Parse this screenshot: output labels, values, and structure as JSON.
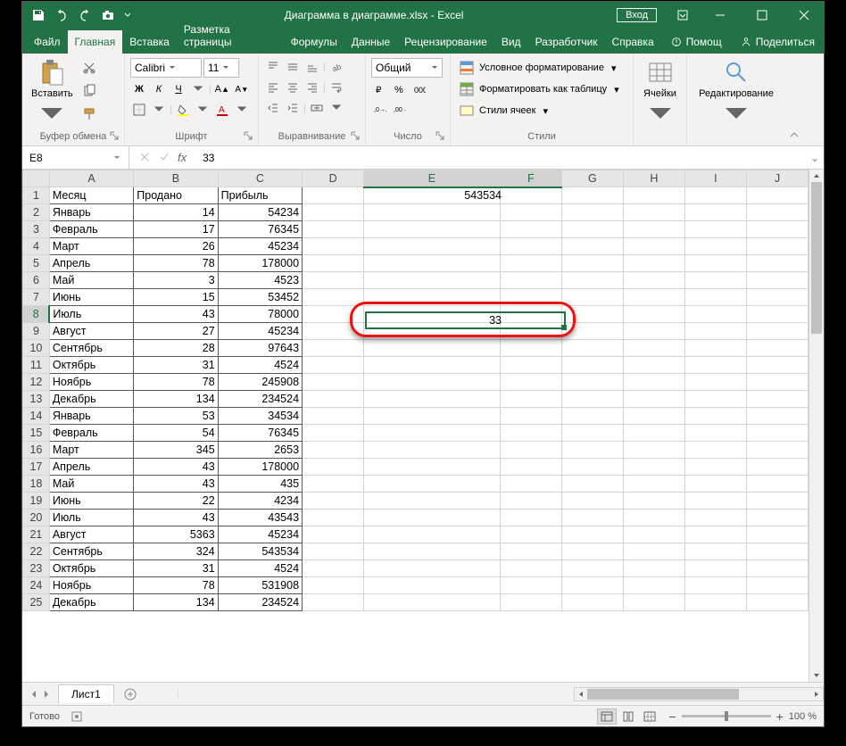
{
  "title": {
    "doc": "Диаграмма в диаграмме.xlsx",
    "app": "Excel",
    "sep": " - "
  },
  "login_btn": "Вход",
  "tabs": [
    "Файл",
    "Главная",
    "Вставка",
    "Разметка страницы",
    "Формулы",
    "Данные",
    "Рецензирование",
    "Вид",
    "Разработчик",
    "Справка"
  ],
  "active_tab": 1,
  "help_hint": "Помощ",
  "share": "Поделиться",
  "ribbon": {
    "clipboard": {
      "paste": "Вставить",
      "title": "Буфер обмена"
    },
    "font": {
      "name": "Calibri",
      "size": "11",
      "title": "Шрифт"
    },
    "align": {
      "title": "Выравнивание"
    },
    "number": {
      "format": "Общий",
      "title": "Число"
    },
    "styles": {
      "cond": "Условное форматирование",
      "table": "Форматировать как таблицу",
      "cell": "Стили ячеек",
      "title": "Стили"
    },
    "cells": {
      "title": "Ячейки"
    },
    "editing": {
      "title": "Редактирование"
    }
  },
  "namebox": "E8",
  "formula": "33",
  "columns": [
    "A",
    "B",
    "C",
    "D",
    "E",
    "F",
    "G",
    "H",
    "I",
    "J"
  ],
  "sel_cols": [
    "E",
    "F"
  ],
  "sel_row": 8,
  "headers": [
    "Месяц",
    "Продано",
    "Прибыль"
  ],
  "rows": [
    {
      "n": 1,
      "a": "Месяц",
      "b": "Продано",
      "c": "Прибыль"
    },
    {
      "n": 2,
      "a": "Январь",
      "b": 14,
      "c": 54234
    },
    {
      "n": 3,
      "a": "Февраль",
      "b": 17,
      "c": 76345
    },
    {
      "n": 4,
      "a": "Март",
      "b": 26,
      "c": 45234
    },
    {
      "n": 5,
      "a": "Апрель",
      "b": 78,
      "c": 178000
    },
    {
      "n": 6,
      "a": "Май",
      "b": 3,
      "c": 4523
    },
    {
      "n": 7,
      "a": "Июнь",
      "b": 15,
      "c": 53452
    },
    {
      "n": 8,
      "a": "Июль",
      "b": 43,
      "c": 78000
    },
    {
      "n": 9,
      "a": "Август",
      "b": 27,
      "c": 45234
    },
    {
      "n": 10,
      "a": "Сентябрь",
      "b": 28,
      "c": 97643
    },
    {
      "n": 11,
      "a": "Октябрь",
      "b": 31,
      "c": 4524
    },
    {
      "n": 12,
      "a": "Ноябрь",
      "b": 78,
      "c": 245908
    },
    {
      "n": 13,
      "a": "Декабрь",
      "b": 134,
      "c": 234524
    },
    {
      "n": 14,
      "a": "Январь",
      "b": 53,
      "c": 34534
    },
    {
      "n": 15,
      "a": "Февраль",
      "b": 54,
      "c": 76345
    },
    {
      "n": 16,
      "a": "Март",
      "b": 345,
      "c": 2653
    },
    {
      "n": 17,
      "a": "Апрель",
      "b": 43,
      "c": 178000
    },
    {
      "n": 18,
      "a": "Май",
      "b": 43,
      "c": 435
    },
    {
      "n": 19,
      "a": "Июнь",
      "b": 22,
      "c": 4234
    },
    {
      "n": 20,
      "a": "Июль",
      "b": 43,
      "c": 43543
    },
    {
      "n": 21,
      "a": "Август",
      "b": 5363,
      "c": 45234
    },
    {
      "n": 22,
      "a": "Сентябрь",
      "b": 324,
      "c": 543534
    },
    {
      "n": 23,
      "a": "Октябрь",
      "b": 31,
      "c": 4524
    },
    {
      "n": 24,
      "a": "Ноябрь",
      "b": 78,
      "c": 531908
    },
    {
      "n": 25,
      "a": "Декабрь",
      "b": 134,
      "c": 234524
    }
  ],
  "e1_value": "543534",
  "e8_value": "33",
  "sheet_tab": "Лист1",
  "status": "Готово",
  "zoom": "100 %"
}
